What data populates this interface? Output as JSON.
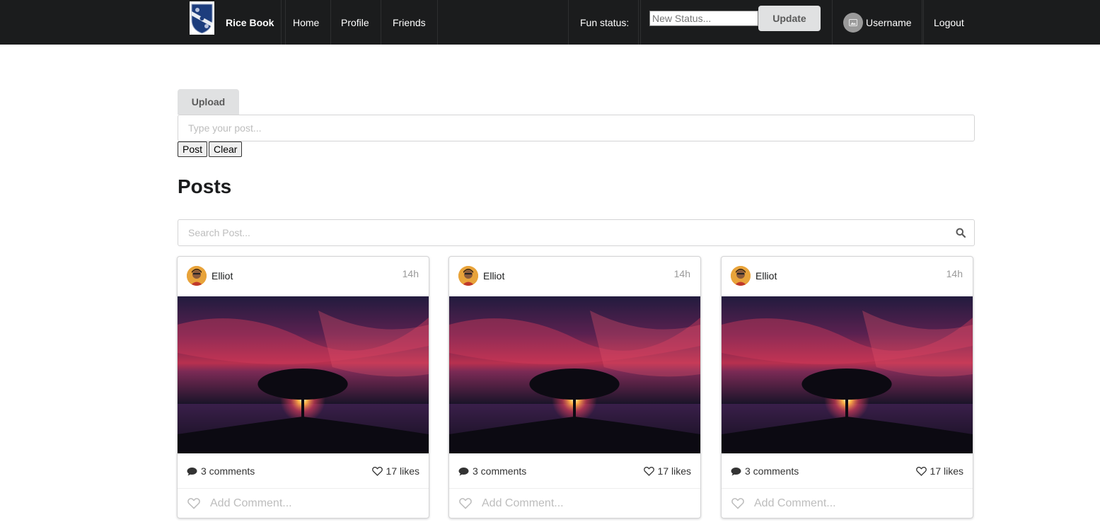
{
  "nav": {
    "brand": "Rice Book",
    "links": [
      "Home",
      "Profile",
      "Friends"
    ],
    "fun_status_label": "Fun status:",
    "status_placeholder": "New Status...",
    "update_label": "Update",
    "username": "Username",
    "logout_label": "Logout"
  },
  "composer": {
    "upload_label": "Upload",
    "post_placeholder": "Type your post...",
    "post_label": "Post",
    "clear_label": "Clear"
  },
  "posts": {
    "heading": "Posts",
    "search_placeholder": "Search Post...",
    "items": [
      {
        "author": "Elliot",
        "time": "14h",
        "comments": "3 comments",
        "likes": "17 likes",
        "comment_placeholder": "Add Comment..."
      },
      {
        "author": "Elliot",
        "time": "14h",
        "comments": "3 comments",
        "likes": "17 likes",
        "comment_placeholder": "Add Comment..."
      },
      {
        "author": "Elliot",
        "time": "14h",
        "comments": "3 comments",
        "likes": "17 likes",
        "comment_placeholder": "Add Comment..."
      }
    ]
  },
  "icons": {
    "logo": "rice-shield-logo",
    "avatar": "image-placeholder-icon",
    "search": "search-icon",
    "comment": "comment-bubble-icon",
    "like": "heart-outline-icon"
  },
  "colors": {
    "navbar_bg": "#1b1c1d",
    "button_bg": "#e0e1e2",
    "border": "#d4d4d5",
    "placeholder": "#bdbdbd"
  }
}
